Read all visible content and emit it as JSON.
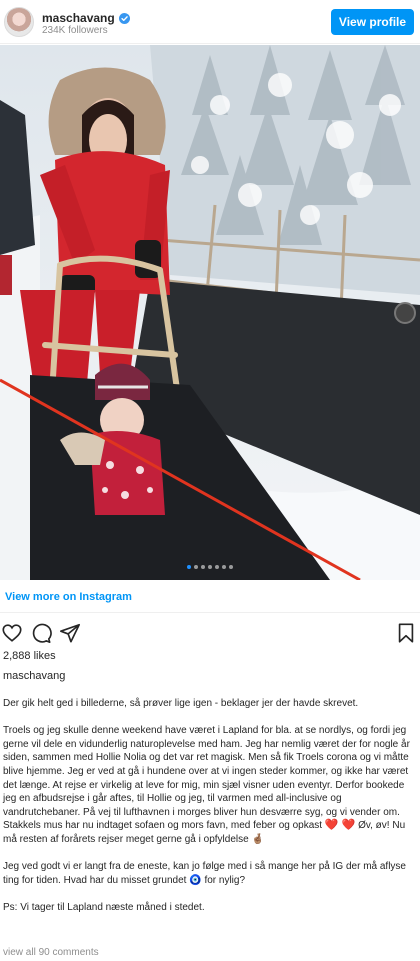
{
  "header": {
    "username": "maschavang",
    "followers": "234K followers",
    "view_profile_label": "View profile"
  },
  "post": {
    "carousel_total": 7,
    "carousel_active": 0,
    "view_more_label": "View more on Instagram",
    "likes": "2,888 likes",
    "owner": "maschavang",
    "caption": {
      "p1": "Der gik helt ged i billederne, så prøver lige igen - beklager jer der havde skrevet.",
      "p2": "Troels og jeg skulle denne weekend have været i Lapland for bla. at se nordlys, og fordi jeg gerne vil dele en vidunderlig naturoplevelse med ham. Jeg har nemlig været der for nogle år siden, sammen med Hollie Nolia og det var ret magisk. Men så fik Troels corona og vi måtte blive hjemme. Jeg er ved at gå i hundene over at vi ingen steder kommer, og ikke har været det længe. At rejse er virkelig at leve for mig, min sjæl visner uden eventyr. Derfor bookede jeg en afbudsrejse i går aftes, til Hollie og jeg, til varmen med all-inclusive og vandrutchebaner. På vej til lufthavnen i morges bliver hun desværre syg, og vi vender om. Stakkels mus har nu indtaget sofaen og mors favn, med feber og opkast",
      "p2_tail": "Øv, øv! Nu må resten af forårets rejser meget gerne gå i opfyldelse",
      "p3": "Jeg ved godt vi er langt fra de eneste, kan jo følge med i så mange her på IG der må aflyse ting for tiden. Hvad har du misset grundet",
      "p3_tail": "for nylig?",
      "p4": "Ps: Vi tager til Lapland næste måned i stedet."
    },
    "view_comments_label": "view all 90 comments"
  },
  "icons": {
    "verified": "verified-badge-icon",
    "like": "heart-icon",
    "comment": "comment-icon",
    "share": "share-icon",
    "save": "bookmark-icon"
  },
  "colors": {
    "accent": "#0095f6",
    "muted": "#8e8e8e",
    "text": "#262626"
  }
}
